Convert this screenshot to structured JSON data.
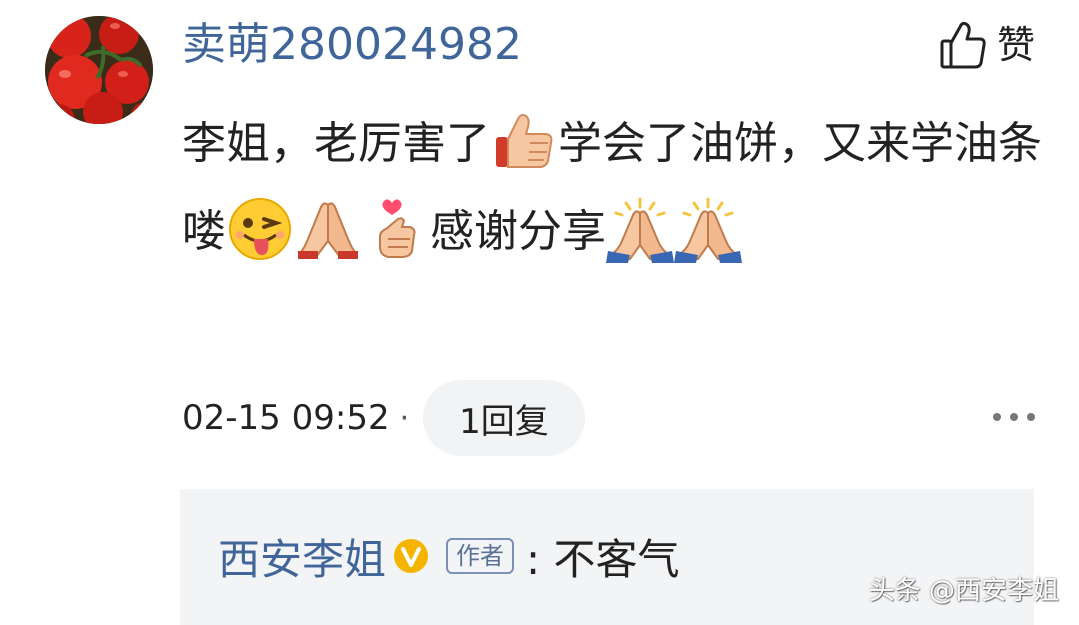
{
  "comment": {
    "username": "卖萌280024982",
    "avatar_icon": "tomatoes-avatar",
    "like_label": "赞",
    "like_icon": "thumbs-up-outline-icon",
    "text_part_1": "李姐，老厉害了",
    "emoji_1": "thumbs-up-emoji",
    "text_part_2": "学会了油饼，又来学油条喽",
    "emoji_2": "wink-tongue-emoji",
    "emoji_3": "praying-hands-emoji",
    "emoji_4": "finger-heart-emoji",
    "text_part_3": "感谢分享",
    "emoji_5": "praying-hands-sparkle-emoji",
    "emoji_6": "praying-hands-sparkle-emoji",
    "timestamp": "02-15 09:52",
    "separator": "·",
    "reply_count_label": "1回复",
    "more_icon": "more-dots-icon"
  },
  "reply": {
    "author": "西安李姐",
    "verified_icon": "verified-v-badge",
    "author_badge": "作者",
    "text": ": 不客气"
  },
  "watermark": "头条 @西安李姐",
  "colors": {
    "username": "#406599",
    "text": "#222222",
    "pill_bg": "#f1f3f5",
    "reply_bg": "#f3f4f6",
    "verified": "#f5b400"
  }
}
